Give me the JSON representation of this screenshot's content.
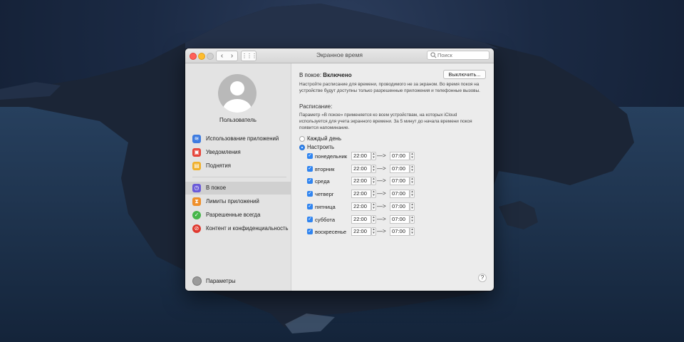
{
  "window": {
    "title": "Экранное время",
    "search_placeholder": "Поиск"
  },
  "sidebar": {
    "username": "Пользователь",
    "group1": [
      {
        "label": "Использование приложений",
        "icon": "layers-icon",
        "color": "#3d7be0"
      },
      {
        "label": "Уведомления",
        "icon": "notification-icon",
        "color": "#e5453a"
      },
      {
        "label": "Поднятия",
        "icon": "pickups-icon",
        "color": "#f0b02b"
      }
    ],
    "group2": [
      {
        "label": "В покое",
        "icon": "downtime-icon",
        "color": "#6a5ad8",
        "selected": true
      },
      {
        "label": "Лимиты приложений",
        "icon": "hourglass-icon",
        "color": "#ef8f2a"
      },
      {
        "label": "Разрешенные всегда",
        "icon": "checkmark-icon",
        "color": "#46b64a"
      },
      {
        "label": "Контент и конфиденциальность",
        "icon": "restriction-icon",
        "color": "#e0392f"
      }
    ],
    "params_label": "Параметры"
  },
  "content": {
    "status_prefix": "В покое:",
    "status_value": "Включено",
    "turn_off_label": "Выключить...",
    "description": "Настройте расписание для времени, проводимого не за экраном. Во время покоя на устройстве будут доступны только разрешенные приложения и телефонные вызовы.",
    "schedule_title": "Расписание:",
    "schedule_description": "Параметр «В покое» применяется ко всем устройствам, на которых iCloud используется для учета экранного времени. За 5 минут до начала времени покоя появится напоминание.",
    "radio_every_day": "Каждый день",
    "radio_custom": "Настроить",
    "days": [
      {
        "label": "понедельник",
        "from": "22:00",
        "to": "07:00"
      },
      {
        "label": "вторник",
        "from": "22:00",
        "to": "07:00"
      },
      {
        "label": "среда",
        "from": "22:00",
        "to": "07:00"
      },
      {
        "label": "четверг",
        "from": "22:00",
        "to": "07:00"
      },
      {
        "label": "пятница",
        "from": "22:00",
        "to": "07:00"
      },
      {
        "label": "суббота",
        "from": "22:00",
        "to": "07:00"
      },
      {
        "label": "воскресенье",
        "from": "22:00",
        "to": "07:00"
      }
    ],
    "arrow": "—>",
    "help": "?"
  }
}
